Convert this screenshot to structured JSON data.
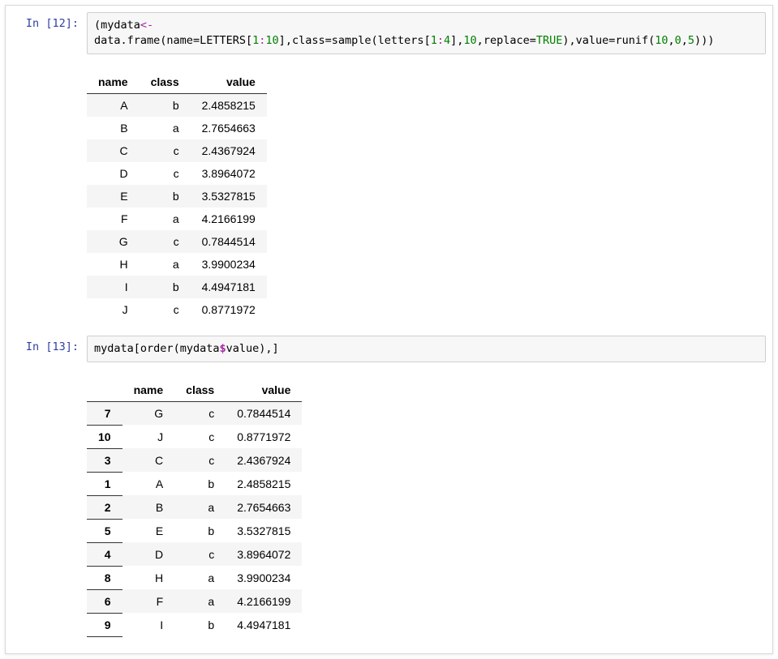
{
  "cells": [
    {
      "prompt_label": "In",
      "prompt_num": "12",
      "code_tokens": [
        {
          "t": "(",
          "c": "tok-paren"
        },
        {
          "t": "mydata",
          "c": "tok-name"
        },
        {
          "t": "<-",
          "c": "tok-assign"
        },
        {
          "t": "data.frame",
          "c": "tok-func"
        },
        {
          "t": "(",
          "c": "tok-paren"
        },
        {
          "t": "name",
          "c": "tok-name"
        },
        {
          "t": "=",
          "c": "tok-eq"
        },
        {
          "t": "LETTERS",
          "c": "tok-name"
        },
        {
          "t": "[",
          "c": "tok-paren"
        },
        {
          "t": "1",
          "c": "tok-num"
        },
        {
          "t": ":",
          "c": "tok-op"
        },
        {
          "t": "10",
          "c": "tok-num"
        },
        {
          "t": "]",
          "c": "tok-paren"
        },
        {
          "t": ",",
          "c": "tok-paren"
        },
        {
          "t": "class",
          "c": "tok-name"
        },
        {
          "t": "=",
          "c": "tok-eq"
        },
        {
          "t": "sample",
          "c": "tok-func"
        },
        {
          "t": "(",
          "c": "tok-paren"
        },
        {
          "t": "letters",
          "c": "tok-name"
        },
        {
          "t": "[",
          "c": "tok-paren"
        },
        {
          "t": "1",
          "c": "tok-num"
        },
        {
          "t": ":",
          "c": "tok-op"
        },
        {
          "t": "4",
          "c": "tok-num"
        },
        {
          "t": "]",
          "c": "tok-paren"
        },
        {
          "t": ",",
          "c": "tok-paren"
        },
        {
          "t": "10",
          "c": "tok-num"
        },
        {
          "t": ",",
          "c": "tok-paren"
        },
        {
          "t": "replace",
          "c": "tok-name"
        },
        {
          "t": "=",
          "c": "tok-eq"
        },
        {
          "t": "TRUE",
          "c": "tok-const"
        },
        {
          "t": ")",
          "c": "tok-paren"
        },
        {
          "t": ",",
          "c": "tok-paren"
        },
        {
          "t": "value",
          "c": "tok-name"
        },
        {
          "t": "=",
          "c": "tok-eq"
        },
        {
          "t": "runif",
          "c": "tok-func"
        },
        {
          "t": "(",
          "c": "tok-paren"
        },
        {
          "t": "10",
          "c": "tok-num"
        },
        {
          "t": ",",
          "c": "tok-paren"
        },
        {
          "t": "0",
          "c": "tok-num"
        },
        {
          "t": ",",
          "c": "tok-paren"
        },
        {
          "t": "5",
          "c": "tok-num"
        },
        {
          "t": ")",
          "c": "tok-paren"
        },
        {
          "t": ")",
          "c": "tok-paren"
        },
        {
          "t": ")",
          "c": "tok-paren"
        }
      ],
      "output_table": {
        "has_rownames": false,
        "headers": [
          "name",
          "class",
          "value"
        ],
        "rows": [
          [
            "A",
            "b",
            "2.4858215"
          ],
          [
            "B",
            "a",
            "2.7654663"
          ],
          [
            "C",
            "c",
            "2.4367924"
          ],
          [
            "D",
            "c",
            "3.8964072"
          ],
          [
            "E",
            "b",
            "3.5327815"
          ],
          [
            "F",
            "a",
            "4.2166199"
          ],
          [
            "G",
            "c",
            "0.7844514"
          ],
          [
            "H",
            "a",
            "3.9900234"
          ],
          [
            "I",
            "b",
            "4.4947181"
          ],
          [
            "J",
            "c",
            "0.8771972"
          ]
        ]
      }
    },
    {
      "prompt_label": "In",
      "prompt_num": "13",
      "code_tokens": [
        {
          "t": "mydata",
          "c": "tok-name"
        },
        {
          "t": "[",
          "c": "tok-paren"
        },
        {
          "t": "order",
          "c": "tok-func"
        },
        {
          "t": "(",
          "c": "tok-paren"
        },
        {
          "t": "mydata",
          "c": "tok-name"
        },
        {
          "t": "$",
          "c": "tok-dollar"
        },
        {
          "t": "value",
          "c": "tok-name"
        },
        {
          "t": ")",
          "c": "tok-paren"
        },
        {
          "t": ",",
          "c": "tok-paren"
        },
        {
          "t": "]",
          "c": "tok-paren"
        }
      ],
      "output_table": {
        "has_rownames": true,
        "headers": [
          "",
          "name",
          "class",
          "value"
        ],
        "rows": [
          [
            "7",
            "G",
            "c",
            "0.7844514"
          ],
          [
            "10",
            "J",
            "c",
            "0.8771972"
          ],
          [
            "3",
            "C",
            "c",
            "2.4367924"
          ],
          [
            "1",
            "A",
            "b",
            "2.4858215"
          ],
          [
            "2",
            "B",
            "a",
            "2.7654663"
          ],
          [
            "5",
            "E",
            "b",
            "3.5327815"
          ],
          [
            "4",
            "D",
            "c",
            "3.8964072"
          ],
          [
            "8",
            "H",
            "a",
            "3.9900234"
          ],
          [
            "6",
            "F",
            "a",
            "4.2166199"
          ],
          [
            "9",
            "I",
            "b",
            "4.4947181"
          ]
        ]
      }
    }
  ]
}
